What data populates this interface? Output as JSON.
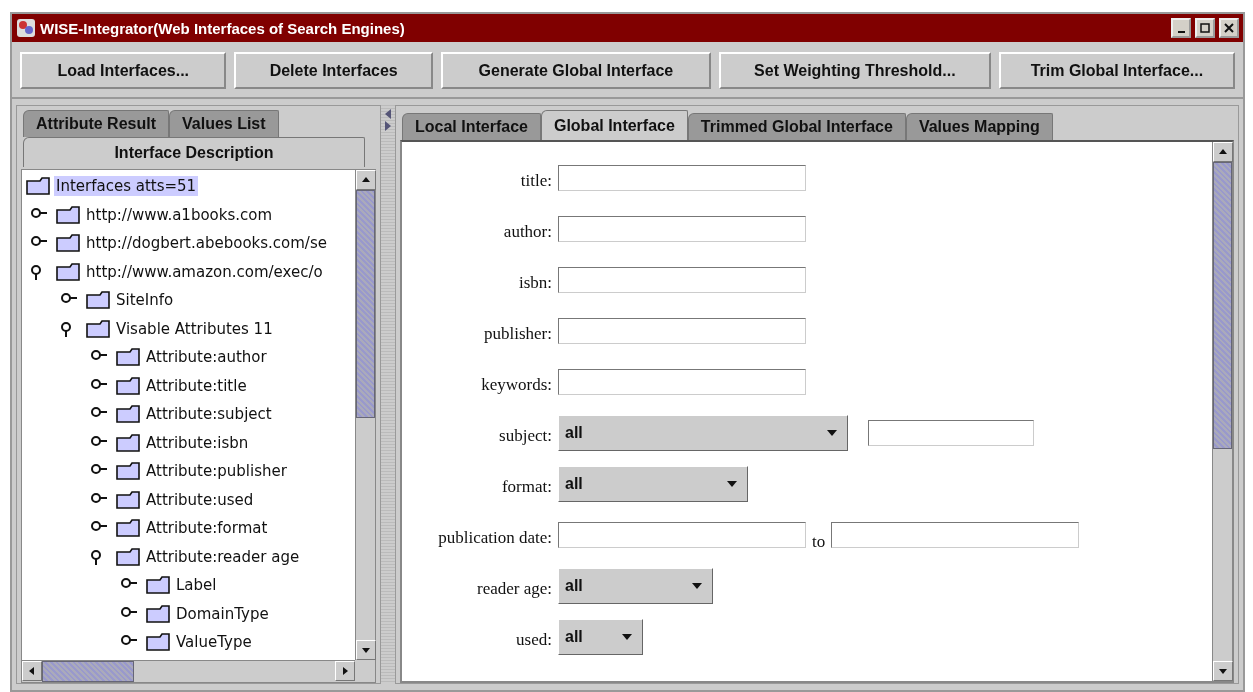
{
  "window": {
    "title": "WISE-Integrator(Web Interfaces of Search Engines)"
  },
  "toolbar": [
    "Load Interfaces...",
    "Delete Interfaces",
    "Generate Global Interface",
    "Set Weighting Threshold...",
    "Trim Global Interface..."
  ],
  "left_tabs": [
    {
      "label": "Attribute Result",
      "selected": false
    },
    {
      "label": "Values List",
      "selected": false
    },
    {
      "label": "Interface Description",
      "selected": true
    }
  ],
  "tree": {
    "label": "Interfaces   atts=51",
    "selected": true,
    "children": [
      {
        "label": "http://www.a1books.com",
        "expanded": false
      },
      {
        "label": "http://dogbert.abebooks.com/se",
        "expanded": false
      },
      {
        "label": "http://www.amazon.com/exec/o",
        "expanded": true,
        "children": [
          {
            "label": "SiteInfo",
            "expanded": false
          },
          {
            "label": "Visable Attributes   11",
            "expanded": true,
            "children": [
              {
                "label": "Attribute:author",
                "expanded": false
              },
              {
                "label": "Attribute:title",
                "expanded": false
              },
              {
                "label": "Attribute:subject",
                "expanded": false
              },
              {
                "label": "Attribute:isbn",
                "expanded": false
              },
              {
                "label": "Attribute:publisher",
                "expanded": false
              },
              {
                "label": "Attribute:used",
                "expanded": false
              },
              {
                "label": "Attribute:format",
                "expanded": false
              },
              {
                "label": "Attribute:reader age",
                "expanded": true,
                "children": [
                  {
                    "label": "Label",
                    "expanded": false
                  },
                  {
                    "label": "DomainType",
                    "expanded": false
                  },
                  {
                    "label": "ValueType",
                    "expanded": false
                  }
                ]
              }
            ]
          }
        ]
      }
    ]
  },
  "right_tabs": [
    {
      "label": "Local Interface",
      "selected": false
    },
    {
      "label": "Global Interface",
      "selected": true
    },
    {
      "label": "Trimmed Global Interface",
      "selected": false
    },
    {
      "label": "Values Mapping",
      "selected": false
    }
  ],
  "form": [
    {
      "kind": "text",
      "label": "title:"
    },
    {
      "kind": "text",
      "label": "author:"
    },
    {
      "kind": "text",
      "label": "isbn:"
    },
    {
      "kind": "text",
      "label": "publisher:"
    },
    {
      "kind": "text",
      "label": "keywords:"
    },
    {
      "kind": "select_text",
      "label": "subject:",
      "value": "all"
    },
    {
      "kind": "select",
      "label": "format:",
      "value": "all"
    },
    {
      "kind": "range",
      "label": "publication date:",
      "joiner": "to"
    },
    {
      "kind": "select",
      "label": "reader age:",
      "value": "all"
    },
    {
      "kind": "select",
      "label": "used:",
      "value": "all"
    }
  ]
}
